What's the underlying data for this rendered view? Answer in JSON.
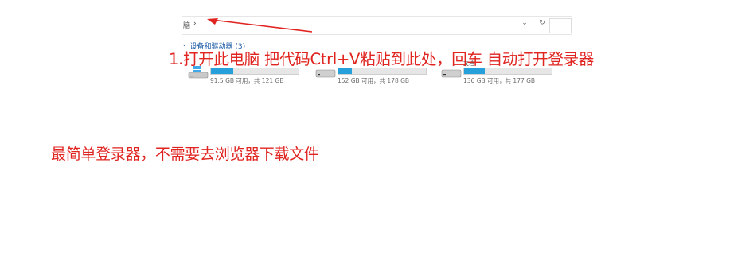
{
  "explorer": {
    "breadcrumb": {
      "location": "脑",
      "separator": "›"
    },
    "address_controls": {
      "dropdown_icon": "chevron-down-icon",
      "refresh_icon": "refresh-icon"
    },
    "group_header": {
      "chevron": "⌄",
      "label": "设备和驱动器 (3)"
    },
    "drives": [
      {
        "name": "",
        "size_text": "91.5 GB 可用，共 121 GB",
        "used_fraction": 0.25,
        "icon": "windows-drive-icon"
      },
      {
        "name": "",
        "size_text": "152 GB 可用，共 178 GB",
        "used_fraction": 0.15,
        "icon": "drive-icon"
      },
      {
        "name": "文档",
        "size_text": "136 GB 可用，共 177 GB",
        "used_fraction": 0.24,
        "icon": "drive-icon"
      }
    ]
  },
  "annotations": {
    "step_text": "1.打开此电脑 把代码Ctrl+V粘贴到此处，回车 自动打开登录器",
    "note_text": "最简单登录器，不需要去浏览器下载文件",
    "color": "#e02420"
  },
  "colors": {
    "progress_fill": "#26a0da",
    "progress_track": "#e6e6e6",
    "link_blue": "#1a5aa6"
  }
}
